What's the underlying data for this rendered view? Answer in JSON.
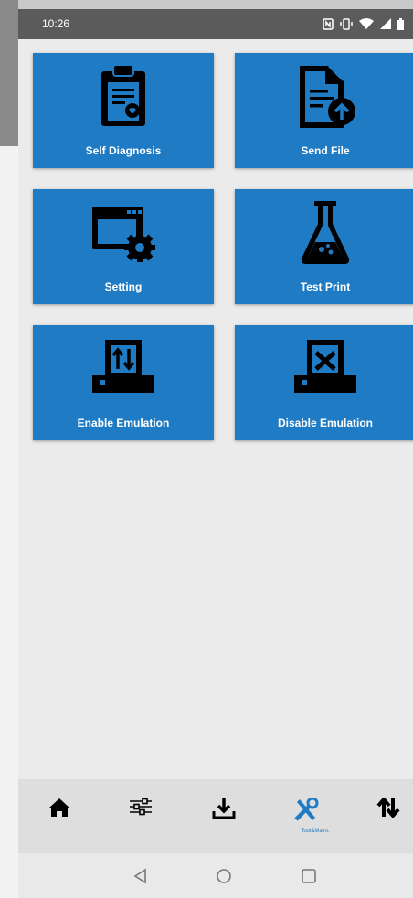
{
  "status_bar": {
    "time": "10:26",
    "icons": [
      "nfc-icon",
      "vibrate-icon",
      "wifi-icon",
      "signal-icon",
      "battery-icon"
    ]
  },
  "tiles": [
    {
      "label": "Self Diagnosis",
      "icon": "clipboard-icon"
    },
    {
      "label": "Send File",
      "icon": "document-upload-icon"
    },
    {
      "label": "Setting",
      "icon": "window-gear-icon"
    },
    {
      "label": "Test Print",
      "icon": "flask-icon"
    },
    {
      "label": "Enable Emulation",
      "icon": "printer-arrows-icon"
    },
    {
      "label": "Disable Emulation",
      "icon": "printer-x-icon"
    }
  ],
  "bottom_nav": {
    "items": [
      "home-icon",
      "sliders-icon",
      "download-icon",
      "tools-icon",
      "transfer-icon"
    ],
    "active_label": "Tool&Maint."
  },
  "colors": {
    "tile_blue": "#1f7bc4",
    "status_bar": "#5b5b5b",
    "background": "#ebebeb"
  }
}
